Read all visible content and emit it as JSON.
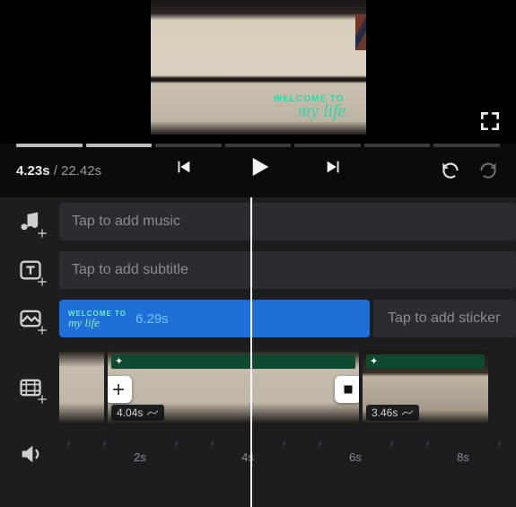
{
  "preview": {
    "watermark_line1": "WELCOME TO",
    "watermark_line2": "my life"
  },
  "transport": {
    "current_time": "4.23s",
    "total_time": "22.42s"
  },
  "tracks": {
    "music": {
      "placeholder": "Tap to add music"
    },
    "subtitle": {
      "placeholder": "Tap to add subtitle"
    },
    "sticker": {
      "clip_watermark_line1": "WELCOME TO",
      "clip_watermark_line2": "my life",
      "clip_duration": "6.29s",
      "placeholder": "Tap to add sticker"
    },
    "video": {
      "clips": [
        {
          "duration": "4.04s",
          "selected": true
        },
        {
          "duration": "3.46s",
          "selected": false
        }
      ]
    },
    "ruler": {
      "labels": [
        "2s",
        "4s",
        "6s",
        "8s"
      ]
    }
  }
}
